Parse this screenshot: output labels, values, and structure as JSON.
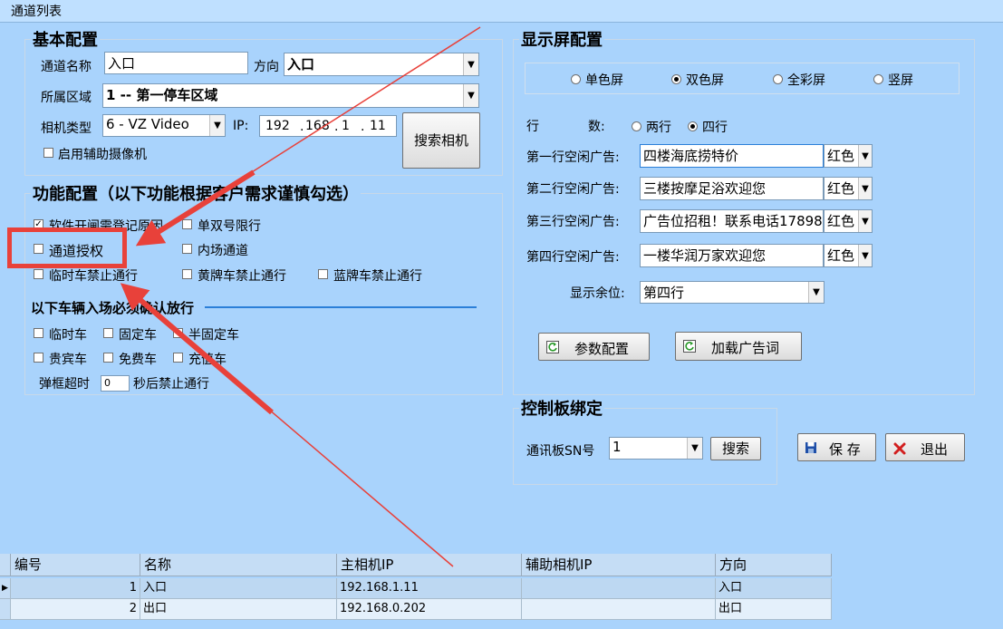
{
  "window": {
    "tab_title": "通道列表"
  },
  "basic": {
    "title": "基本配置",
    "channel_name_label": "通道名称",
    "channel_name_value": "入口",
    "direction_label": "方向",
    "direction_value": "入口",
    "area_label": "所属区域",
    "area_value": "1 -- 第一停车区域",
    "camera_type_label": "相机类型",
    "camera_type_value": "6 - VZ Video",
    "ip_label": "IP:",
    "ip_parts": [
      "192",
      "168",
      "1",
      "11"
    ],
    "search_camera_button": "搜索相机",
    "aux_camera_label": "启用辅助摄像机"
  },
  "function": {
    "title": "功能配置（以下功能根据客户需求谨慎勾选）",
    "items": [
      {
        "label": "软件开闸需登记原因",
        "checked": true
      },
      {
        "label": "单双号限行",
        "checked": false
      },
      {
        "label": "通道授权",
        "checked": false
      },
      {
        "label": "内场通道",
        "checked": false
      },
      {
        "label": "临时车禁止通行",
        "checked": false
      },
      {
        "label": "黄牌车禁止通行",
        "checked": false
      },
      {
        "label": "蓝牌车禁止通行",
        "checked": false
      }
    ],
    "confirm_title": "以下车辆入场必须确认放行",
    "vehicles": [
      {
        "label": "临时车",
        "checked": false
      },
      {
        "label": "固定车",
        "checked": false
      },
      {
        "label": "半固定车",
        "checked": false
      },
      {
        "label": "贵宾车",
        "checked": false
      },
      {
        "label": "免费车",
        "checked": false
      },
      {
        "label": "充值车",
        "checked": false
      }
    ],
    "timeout_label": "弹框超时",
    "timeout_value": "0",
    "timeout_suffix": "秒后禁止通行"
  },
  "display": {
    "title": "显示屏配置",
    "screen_types": [
      {
        "label": "单色屏",
        "selected": false
      },
      {
        "label": "双色屏",
        "selected": true
      },
      {
        "label": "全彩屏",
        "selected": false
      },
      {
        "label": "竖屏",
        "selected": false
      }
    ],
    "rows_label_1": "行",
    "rows_label_2": "数:",
    "row_options": [
      {
        "label": "两行",
        "selected": false
      },
      {
        "label": "四行",
        "selected": true
      }
    ],
    "ads": [
      {
        "label": "第一行空闲广告:",
        "text": "四楼海底捞特价",
        "color": "红色"
      },
      {
        "label": "第二行空闲广告:",
        "text": "三楼按摩足浴欢迎您",
        "color": "红色"
      },
      {
        "label": "第三行空闲广告:",
        "text": "广告位招租！联系电话17898",
        "color": "红色"
      },
      {
        "label": "第四行空闲广告:",
        "text": "一楼华润万家欢迎您",
        "color": "红色"
      }
    ],
    "remaining_label": "显示余位:",
    "remaining_value": "第四行",
    "param_button": "参数配置",
    "load_ads_button": "加载广告词"
  },
  "control": {
    "title": "控制板绑定",
    "sn_label": "通讯板SN号",
    "sn_value": "1",
    "search_button": "搜索"
  },
  "actions": {
    "save": "保 存",
    "exit": "退出"
  },
  "table": {
    "columns": [
      "编号",
      "名称",
      "主相机IP",
      "辅助相机IP",
      "方向"
    ],
    "rows": [
      {
        "id": "1",
        "name": "入口",
        "main_ip": "192.168.1.11",
        "aux_ip": "",
        "direction": "入口"
      },
      {
        "id": "2",
        "name": "出口",
        "main_ip": "192.168.0.202",
        "aux_ip": "",
        "direction": "出口"
      }
    ]
  },
  "colors": {
    "background": "#a9d3fc",
    "highlight": "#e8413a",
    "accent": "#2b7fd8"
  }
}
